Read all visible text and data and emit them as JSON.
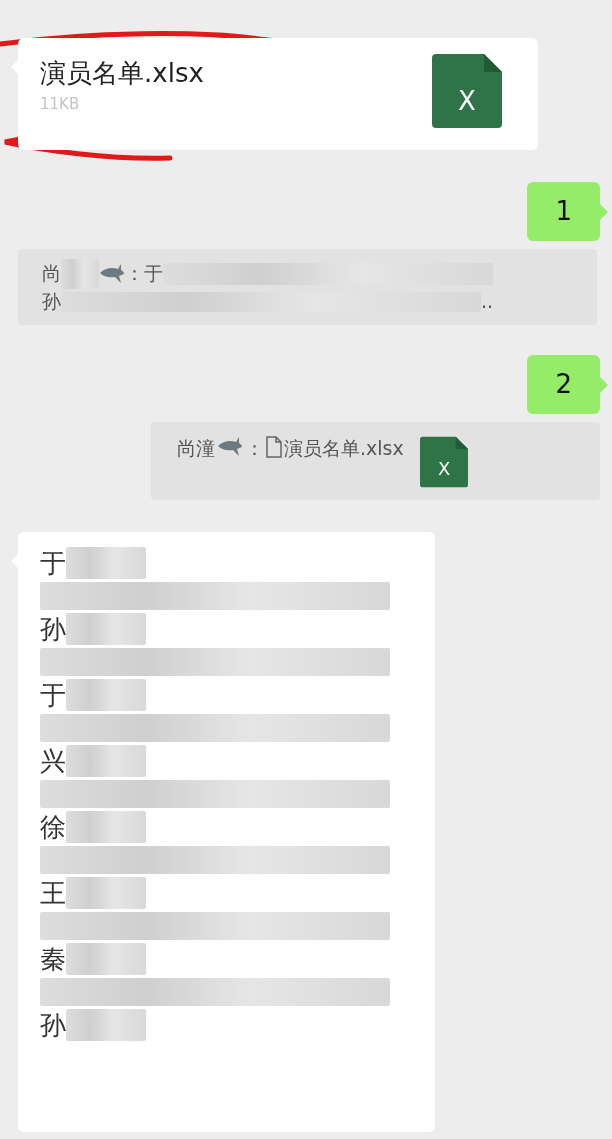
{
  "messages": [
    {
      "kind": "file",
      "outgoing": false,
      "file_name": "演员名单.xlsx",
      "size": "11KB",
      "icon_letter": "X",
      "annotated": true
    },
    {
      "kind": "text",
      "outgoing": true,
      "text": "1"
    },
    {
      "kind": "quote",
      "sender": "尚",
      "colon": "：",
      "body": "于",
      "line2": "孙",
      "ellipsis": ".."
    },
    {
      "kind": "text",
      "outgoing": true,
      "text": "2"
    },
    {
      "kind": "quote_file",
      "sender": "尚潼",
      "colon": "：",
      "file_name": "演员名单.xlsx",
      "icon_letter": "X"
    },
    {
      "kind": "list",
      "outgoing": false,
      "items": [
        {
          "kind": "name",
          "text": "于"
        },
        {
          "kind": "redacted"
        },
        {
          "kind": "name",
          "text": "孙"
        },
        {
          "kind": "redacted"
        },
        {
          "kind": "name",
          "text": "于"
        },
        {
          "kind": "redacted"
        },
        {
          "kind": "name",
          "text": "兴"
        },
        {
          "kind": "redacted"
        },
        {
          "kind": "name",
          "text": "徐"
        },
        {
          "kind": "redacted"
        },
        {
          "kind": "name",
          "text": "王"
        },
        {
          "kind": "redacted"
        },
        {
          "kind": "name",
          "text": "秦"
        },
        {
          "kind": "redacted"
        },
        {
          "kind": "name",
          "text": "孙"
        }
      ]
    }
  ]
}
